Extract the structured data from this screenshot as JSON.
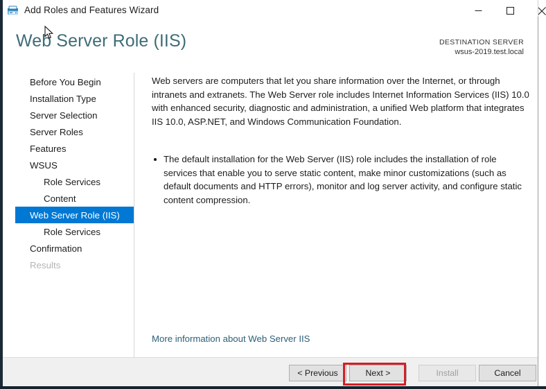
{
  "window": {
    "title": "Add Roles and Features Wizard",
    "icon": "server-roles-icon",
    "controls": {
      "minimize": "minimize-icon",
      "maximize": "maximize-icon",
      "close": "close-icon"
    }
  },
  "header": {
    "page_title": "Web Server Role (IIS)",
    "destination_label": "DESTINATION SERVER",
    "destination_value": "wsus-2019.test.local",
    "title_color": "#3f6c77"
  },
  "sidebar": {
    "items": [
      {
        "label": "Before You Begin",
        "indent": false,
        "state": "normal"
      },
      {
        "label": "Installation Type",
        "indent": false,
        "state": "normal"
      },
      {
        "label": "Server Selection",
        "indent": false,
        "state": "normal"
      },
      {
        "label": "Server Roles",
        "indent": false,
        "state": "normal"
      },
      {
        "label": "Features",
        "indent": false,
        "state": "normal"
      },
      {
        "label": "WSUS",
        "indent": false,
        "state": "normal"
      },
      {
        "label": "Role Services",
        "indent": true,
        "state": "normal"
      },
      {
        "label": "Content",
        "indent": true,
        "state": "normal"
      },
      {
        "label": "Web Server Role (IIS)",
        "indent": false,
        "state": "selected"
      },
      {
        "label": "Role Services",
        "indent": true,
        "state": "normal"
      },
      {
        "label": "Confirmation",
        "indent": false,
        "state": "normal"
      },
      {
        "label": "Results",
        "indent": false,
        "state": "disabled"
      }
    ],
    "selected_color": "#0078d4"
  },
  "content": {
    "intro_paragraph": "Web servers are computers that let you share information over the Internet, or through intranets and extranets. The Web Server role includes Internet Information Services (IIS) 10.0 with enhanced security, diagnostic and administration, a unified Web platform that integrates IIS 10.0, ASP.NET, and Windows Communication Foundation.",
    "bullets": [
      "The default installation for the Web Server (IIS) role includes the installation of role services that enable you to serve static content, make minor customizations (such as default documents and HTTP errors), monitor and log server activity, and configure static content compression."
    ],
    "more_info_link": "More information about Web Server IIS",
    "link_color": "#2c5f77"
  },
  "footer": {
    "previous_label": "< Previous",
    "next_label": "Next >",
    "install_label": "Install",
    "cancel_label": "Cancel",
    "install_enabled": false,
    "highlight_color": "#d31f26",
    "highlighted_button": "Next >"
  }
}
